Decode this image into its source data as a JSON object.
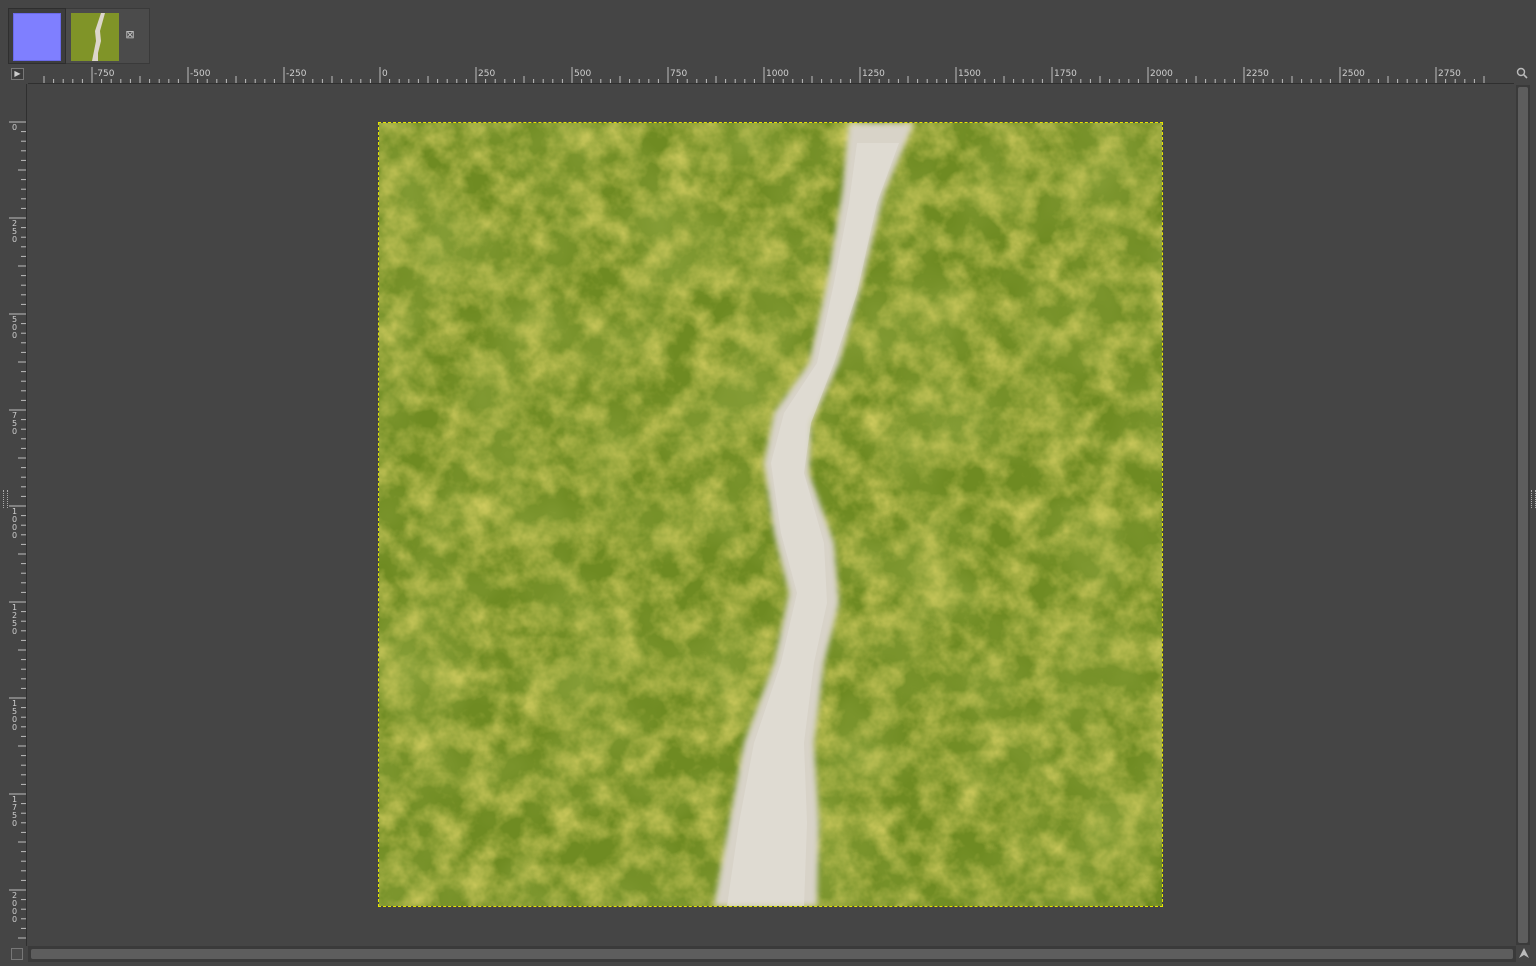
{
  "tabs": [
    {
      "name": "normal-map-image",
      "color": "#7f7fff"
    },
    {
      "name": "grass-path-image"
    }
  ],
  "tab_close_glyph": "⊠",
  "hruler": {
    "labels": [
      "-750",
      "-500",
      "-250",
      "0",
      "250",
      "500",
      "750",
      "1000",
      "1250",
      "1500",
      "1750",
      "2000",
      "2250",
      "2500",
      "2750"
    ]
  },
  "vruler": {
    "labels": [
      "0",
      "250",
      "500",
      "750",
      "1000",
      "1250",
      "1500",
      "1750",
      "2000"
    ]
  },
  "icons": {
    "ruler_corner": "play-right-icon",
    "zoom": "magnifier-icon",
    "navigate": "navigate-arrow-icon",
    "quick_mask": "quick-mask-icon",
    "tab_close": "close-icon"
  },
  "colors": {
    "background": "#454545",
    "grass": "#6f8b22",
    "grass_light": "#a9a625",
    "path": "#d8d3c8",
    "boundary": "#e6e600"
  }
}
